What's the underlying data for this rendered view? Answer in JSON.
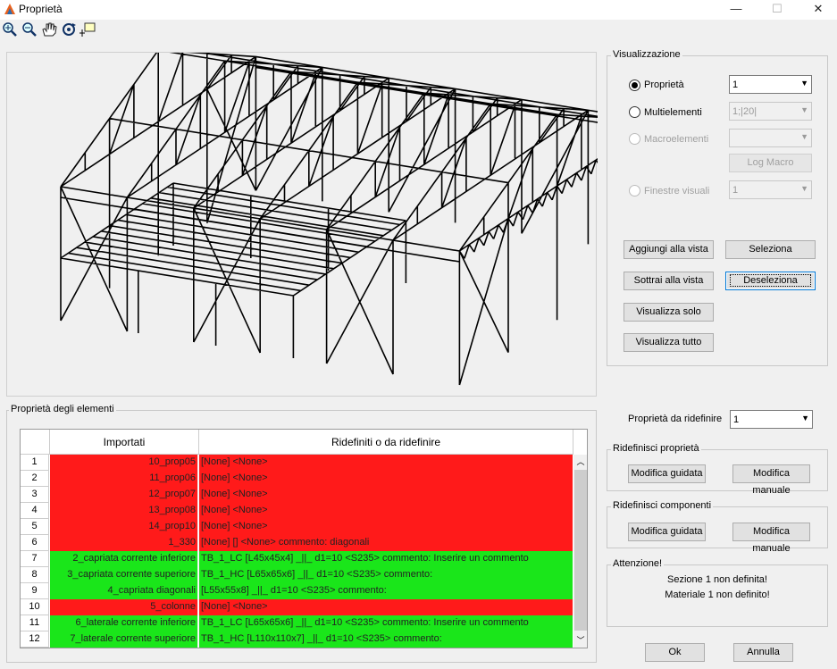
{
  "window": {
    "title": "Proprietà",
    "minimize": "—",
    "maximize": "☐",
    "close": "✕"
  },
  "toolbar": {
    "icons": [
      "zoom-in-icon",
      "zoom-out-icon",
      "pan-hand-icon",
      "rotate-icon",
      "data-cursor-icon"
    ]
  },
  "visualizzazione": {
    "title": "Visualizzazione",
    "proprieta": {
      "label": "Proprietà",
      "value": "1",
      "selected": true
    },
    "multielementi": {
      "label": "Multielementi",
      "value": "1;|20|"
    },
    "macroelementi": {
      "label": "Macroelementi",
      "value": ""
    },
    "log_macro": "Log Macro",
    "finestre_visuali": {
      "label": "Finestre visuali",
      "value": "1"
    },
    "buttons": {
      "aggiungi": "Aggiungi alla vista",
      "seleziona": "Seleziona",
      "sottrai": "Sottrai alla vista",
      "deseleziona": "Deseleziona",
      "visualizza_solo": "Visualizza solo",
      "visualizza_tutto": "Visualizza tutto"
    }
  },
  "elementi": {
    "title": "Proprietà degli elementi",
    "headers": [
      "Importati",
      "Ridefiniti o da ridefinire"
    ],
    "rows": [
      {
        "n": "1",
        "imp": "10_prop05",
        "rid": "[None]  <None>",
        "status": "red"
      },
      {
        "n": "2",
        "imp": "11_prop06",
        "rid": "[None]  <None>",
        "status": "red"
      },
      {
        "n": "3",
        "imp": "12_prop07",
        "rid": "[None]  <None>",
        "status": "red"
      },
      {
        "n": "4",
        "imp": "13_prop08",
        "rid": "[None]  <None>",
        "status": "red"
      },
      {
        "n": "5",
        "imp": "14_prop10",
        "rid": "[None]  <None>",
        "status": "red"
      },
      {
        "n": "6",
        "imp": "1_330",
        "rid": "[None] [] <None> commento: diagonali",
        "status": "red"
      },
      {
        "n": "7",
        "imp": "2_capriata corrente inferiore",
        "rid": "TB_1_LC  [L45x45x4]  _||_  d1=10 <S235> commento: Inserire un commento",
        "status": "green"
      },
      {
        "n": "8",
        "imp": "3_capriata corrente superiore",
        "rid": "TB_1_HC  [L65x65x6]  _||_  d1=10 <S235> commento:",
        "status": "green"
      },
      {
        "n": "9",
        "imp": "4_capriata diagonali",
        "rid": "[L55x55x8]  _||_  d1=10 <S235> commento:",
        "status": "green"
      },
      {
        "n": "10",
        "imp": "5_colonne",
        "rid": "[None]  <None>",
        "status": "red"
      },
      {
        "n": "11",
        "imp": "6_laterale corrente inferiore",
        "rid": "TB_1_LC  [L65x65x6]  _||_  d1=10 <S235> commento: Inserire un commento",
        "status": "green"
      },
      {
        "n": "12",
        "imp": "7_laterale corrente superiore",
        "rid": "TB_1_HC  [L110x110x7]  _||_  d1=10 <S235> commento:",
        "status": "green"
      }
    ]
  },
  "ridefinire": {
    "label": "Proprietà da ridefinire",
    "value": "1"
  },
  "ridefinisci_proprieta": {
    "title": "Ridefinisci proprietà",
    "guidata": "Modifica guidata",
    "manuale": "Modifica manuale"
  },
  "ridefinisci_componenti": {
    "title": "Ridefinisci componenti",
    "guidata": "Modifica guidata",
    "manuale": "Modifica manuale"
  },
  "attenzione": {
    "title": "Attenzione!",
    "line1": "Sezione 1 non definita!",
    "line2": "Materiale 1 non definito!"
  },
  "footer": {
    "ok": "Ok",
    "annulla": "Annulla"
  },
  "colors": {
    "red": "#ff1a1a",
    "green": "#1ae61a",
    "focus": "#0078d7"
  }
}
